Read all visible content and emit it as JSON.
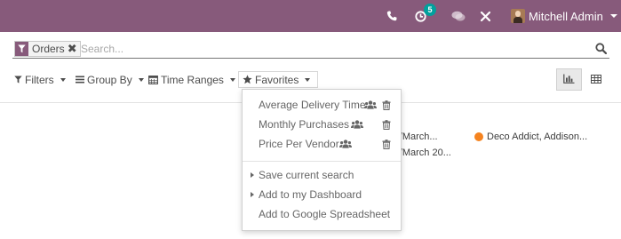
{
  "navbar": {
    "phone_icon": "phone-icon",
    "activity_icon": "clock-icon",
    "activity_badge": "5",
    "chat_icon": "chat-icon",
    "debug_icon": "tools-icon",
    "user_name": "Mitchell Admin",
    "color": "#875a7b"
  },
  "search": {
    "facet_label": "Orders",
    "facet_icon": "filter-icon",
    "placeholder": "Search..."
  },
  "toolbar": {
    "filters_label": "Filters",
    "groupby_label": "Group By",
    "timeranges_label": "Time Ranges",
    "favorites_label": "Favorites",
    "views": [
      "graph-icon",
      "table-icon"
    ],
    "active_view": "graph-icon"
  },
  "background": {
    "cell_1": "or/March...",
    "cell_2": "er/March 20...",
    "cell_3": "Deco Addict, Addison...",
    "dot_color": "#f5831f"
  },
  "favorites_menu": {
    "saved": [
      {
        "label": "Average Delivery Time",
        "shared_icon": "users-icon",
        "delete_icon": "trash-icon"
      },
      {
        "label": "Monthly Purchases",
        "shared_icon": "users-icon",
        "delete_icon": "trash-icon"
      },
      {
        "label": "Price Per Vendor",
        "shared_icon": "users-icon",
        "delete_icon": "trash-icon"
      }
    ],
    "save_current_search": "Save current search",
    "add_to_dashboard": "Add to my Dashboard",
    "add_to_spreadsheet": "Add to Google Spreadsheet"
  }
}
